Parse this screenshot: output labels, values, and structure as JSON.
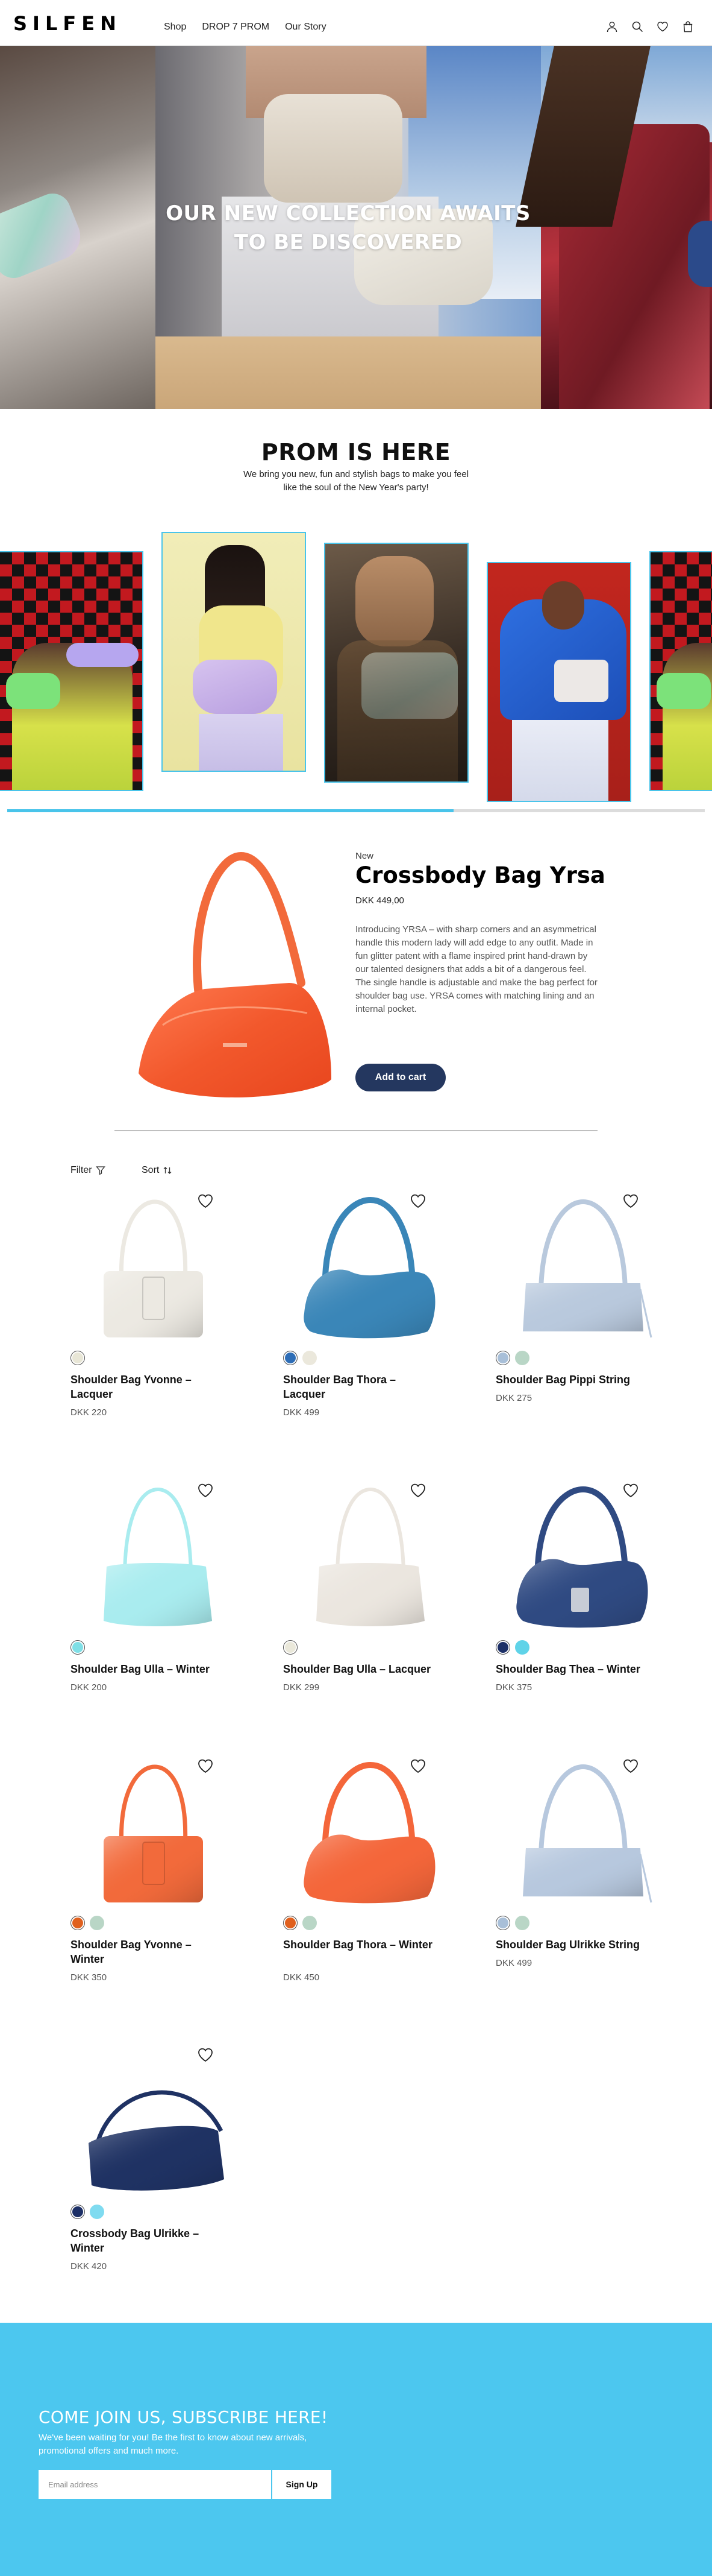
{
  "header": {
    "logo": "SILFEN",
    "nav": [
      "Shop",
      "DROP 7 PROM",
      "Our Story"
    ],
    "icons": [
      "user-icon",
      "search-icon",
      "heart-icon",
      "bag-icon"
    ]
  },
  "hero": {
    "title_line1": "OUR NEW COLLECTION AWAITS",
    "title_line2": "TO BE DISCOVERED"
  },
  "prom": {
    "title": "PROM IS HERE",
    "subtitle": "We bring you new, fun and stylish bags to make you feel like the soul of the New Year's party!",
    "carousel_progress": 0.64
  },
  "featured": {
    "badge": "New",
    "name": "Crossbody Bag Yrsa",
    "price": "DKK 449,00",
    "description": "Introducing YRSA – with sharp corners and an asymmetrical handle this modern lady will add edge to any outfit. Made in fun glitter patent with a flame inspired print hand-drawn by our talented designers that adds a bit of a dangerous feel. The single handle is adjustable and make the bag perfect for shoulder bag use. YRSA comes with matching lining and an internal pocket.",
    "cta": "Add to cart"
  },
  "toolbar": {
    "filter_label": "Filter",
    "sort_label": "Sort"
  },
  "products": [
    {
      "name": "Shoulder Bag Yvonne – Lacquer",
      "price": "DKK 220",
      "colors": [
        "#e8e6d6"
      ],
      "bag_color": "#ece9e2",
      "style": "flap"
    },
    {
      "name": "Shoulder Bag Thora – Lacquer",
      "price": "DKK 499",
      "colors": [
        "#2d6db6",
        "#ebe8dc"
      ],
      "bag_color": "#3a86b8",
      "style": "hobo"
    },
    {
      "name": "Shoulder Bag Pippi String",
      "price": "DKK 275",
      "colors": [
        "#a8bfd8",
        "#b9d6c6"
      ],
      "bag_color": "#b9c9dd",
      "style": "box"
    },
    {
      "name": "Shoulder Bag Ulla – Winter",
      "price": "DKK 200",
      "colors": [
        "#7fdfe6"
      ],
      "bag_color": "#a9ecef",
      "style": "slouch"
    },
    {
      "name": "Shoulder Bag Ulla – Lacquer",
      "price": "DKK 299",
      "colors": [
        "#eae8da"
      ],
      "bag_color": "#ebe6df",
      "style": "slouch"
    },
    {
      "name": "Shoulder Bag Thea – Winter",
      "price": "DKK 375",
      "colors": [
        "#1c2f66",
        "#5fd3e8"
      ],
      "bag_color": "#2f4a82",
      "style": "hobo"
    },
    {
      "name": "Shoulder Bag Yvonne – Winter",
      "price": "DKK 350",
      "colors": [
        "#e0601e",
        "#b9d6c6"
      ],
      "bag_color": "#f26a3b",
      "style": "flap"
    },
    {
      "name": "Shoulder Bag Thora – Winter",
      "price": "DKK 450",
      "colors": [
        "#e0601e",
        "#b9d6c6"
      ],
      "bag_color": "#f4663a",
      "style": "hobo"
    },
    {
      "name": "Shoulder Bag Ulrikke String",
      "price": "DKK 499",
      "colors": [
        "#a8bfd8",
        "#b9d6c6"
      ],
      "bag_color": "#b7c8de",
      "style": "box"
    },
    {
      "name": "Crossbody Bag Ulrikke – Winter",
      "price": "DKK 420",
      "colors": [
        "#1c2f66",
        "#7fdbf0"
      ],
      "bag_color": "#1f3263",
      "style": "cross"
    }
  ],
  "newsletter": {
    "title": "COME JOIN US, SUBSCRIBE HERE!",
    "text": "We've been waiting for you! Be the first to know about new arrivals, promotional offers and much more.",
    "placeholder": "Email address",
    "button": "Sign Up"
  },
  "colors": {
    "accent_blue": "#49c4ea",
    "newsletter_bg": "#4cc7ef",
    "cart_button": "#24375f"
  }
}
